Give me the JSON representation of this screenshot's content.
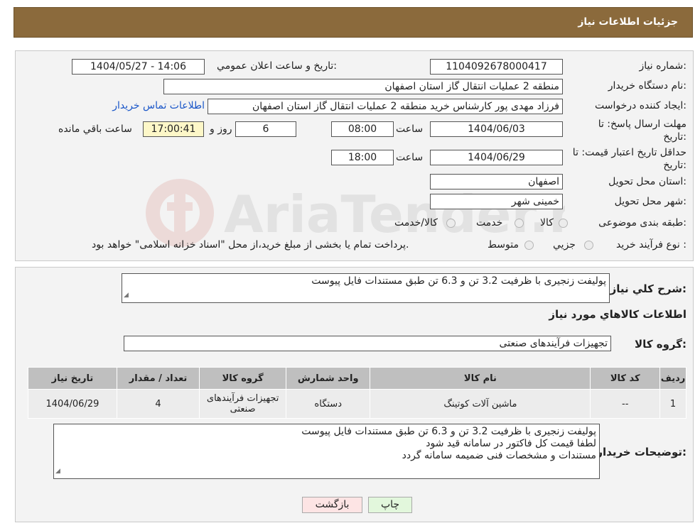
{
  "header": {
    "title": "جزئیات اطلاعات نیاز"
  },
  "form": {
    "need_number_label": "شماره نیاز:",
    "need_number": "1104092678000417",
    "announce_label": "تاریخ و ساعت اعلان عمومي:",
    "announce_value": "1404/05/27 - 14:06",
    "buyer_org_label": "نام دستگاه خریدار:",
    "buyer_org": "منطقه 2 عملیات انتقال گاز استان اصفهان",
    "creator_label": "ایجاد کننده درخواست:",
    "creator": "فرزاد مهدی پور کارشناس خرید منطقه 2 عملیات انتقال گاز استان اصفهان",
    "buyer_contact_link": "اطلاعات تماس خریدار",
    "reply_deadline_label": "مهلت ارسال پاسخ: تا تاریخ:",
    "reply_date": "1404/06/03",
    "time_label": "ساعت",
    "reply_time": "08:00",
    "days_value": "6",
    "days_label": "روز و",
    "remaining_time": "17:00:41",
    "remaining_label": "ساعت باقي مانده",
    "price_validity_label": "حداقل تاریخ اعتبار قیمت: تا تاریخ:",
    "price_date": "1404/06/29",
    "price_time": "18:00",
    "province_label": "استان محل تحویل:",
    "province": "اصفهان",
    "city_label": "شهر محل تحویل:",
    "city": "خمینی شهر",
    "category_label": "طبقه بندی موضوعی:",
    "category_options": [
      "کالا",
      "خدمت",
      "کالا/خدمت"
    ],
    "process_label": "نوع فرآیند خرید :",
    "process_options": [
      "جزیي",
      "متوسط"
    ],
    "process_note": "پرداخت تمام یا بخشی از مبلغ خرید،از محل \"اسناد خزانه اسلامی\" خواهد بود."
  },
  "details": {
    "summary_label": "شرح کلي نیاز:",
    "summary_text": "پولیفت زنجیری با ظرفیت 3.2 تن و  6.3 تن طبق مستندات فایل پیوست",
    "items_heading": "اطلاعات کالاهاي مورد نیاز",
    "group_label": "گروه کالا:",
    "group_value": "تجهیزات فرآیندهای صنعتی",
    "table": {
      "headers": [
        "ردیف",
        "کد کالا",
        "نام کالا",
        "واحد شمارش",
        "گروه کالا",
        "تعداد / مقدار",
        "تاریخ نیاز"
      ],
      "rows": [
        [
          "1",
          "--",
          "ماشین آلات کوتینگ",
          "دستگاه",
          "تجهیزات فرآیندهای صنعتی",
          "4",
          "1404/06/29"
        ]
      ]
    },
    "buyer_notes_label": "توضیحات خریدار:",
    "buyer_notes": [
      "پولیفت زنجیری با ظرفیت 3.2 تن و  6.3 تن طبق مستندات فایل پیوست",
      "لطفا قیمت کل فاکتور در سامانه قید شود",
      "مستندات و مشخصات فنی ضمیمه سامانه گردد"
    ]
  },
  "buttons": {
    "print": "چاپ",
    "back": "بازگشت"
  },
  "watermark": {
    "text": "AriaTender.neT"
  },
  "colors": {
    "header_bg": "#8b6a3c",
    "link": "#1a56c8",
    "time_highlight": "#fdf7c8"
  }
}
